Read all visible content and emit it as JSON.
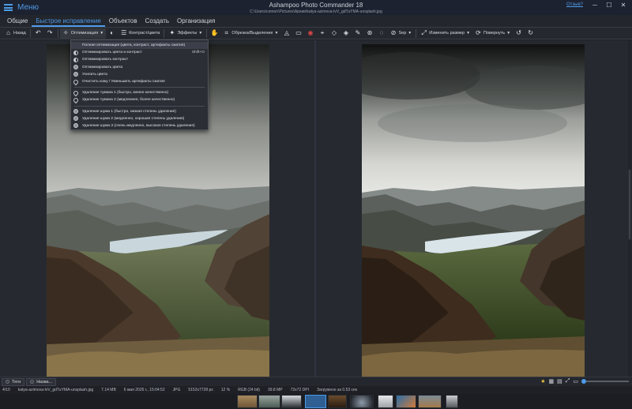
{
  "app": {
    "menu_label": "Меню",
    "title": "Ashampoo Photo Commander 18",
    "path": "C:\\Users\\comon\\Pictures\\Архив\\katya-azimova-lvV_gdTuYMA-unsplash.jpg",
    "feedback": "Отзыв?"
  },
  "tabs": [
    "Общие",
    "Быстрое исправление",
    "Объектов",
    "Создать",
    "Организация"
  ],
  "toolbar": {
    "back": "Назад",
    "optimization": "Оптимизация",
    "contrast_color": "Контраст/цвета",
    "effects": "Эффекты",
    "crop": "Обрезка/Выделение",
    "sepia": "Sep",
    "resize": "Изменить размер",
    "rotate": "Повернуть"
  },
  "dropdown": {
    "items": [
      {
        "label": "Полная оптимизация (цвета, контраст, артефакты сжатия)",
        "shortcut": "",
        "icon": "magic-wand"
      },
      {
        "label": "Оптимизировать цвета и контраст",
        "shortcut": "Shift+O",
        "icon": "half-circle"
      },
      {
        "label": "Оптимизировать контраст",
        "shortcut": "",
        "icon": "half-circle"
      },
      {
        "label": "Оптимизировать цвета",
        "shortcut": "",
        "icon": "color-circle"
      },
      {
        "label": "Усилить цвета",
        "shortcut": "",
        "icon": "color-circle"
      },
      {
        "label": "Очистить кожу / Уменьшить артефакты сжатия",
        "shortcut": "",
        "icon": "drop"
      },
      {
        "label": "Удаление тумана 1 (быстро, менее качественно)",
        "shortcut": "",
        "icon": "drop"
      },
      {
        "label": "Удаление тумана 2 (медленнее, более качественно)",
        "shortcut": "",
        "icon": "drop"
      },
      {
        "label": "Удаление шума 1 (быстро, низкая степень удаления)",
        "shortcut": "",
        "icon": "noise"
      },
      {
        "label": "Удаление шума 2 (медленно, хорошая степень удаления)",
        "shortcut": "",
        "icon": "noise"
      },
      {
        "label": "Удаление шума 3 (очень медленно, высокая степень удаления)",
        "shortcut": "",
        "icon": "noise"
      }
    ]
  },
  "status": {
    "tab1": "Теги",
    "tab2": "Назва...",
    "counter": "4/10",
    "filename": "katya-azimova-lvV_gdTuYMA-unsplash.jpg",
    "filesize": "7.14 MB",
    "date": "6 мая 2026 г., 15:04:52",
    "format": "JPG",
    "dimensions": "5152x7728 px",
    "zoom": "12 %",
    "color_mode": "RGB (24 bit)",
    "megapixels": "39.8 MP",
    "dpi": "72x72 DPI",
    "load_time": "Загружено за 0.53 сек"
  },
  "colors": {
    "accent": "#4d9be8",
    "background": "#1e1f22"
  }
}
